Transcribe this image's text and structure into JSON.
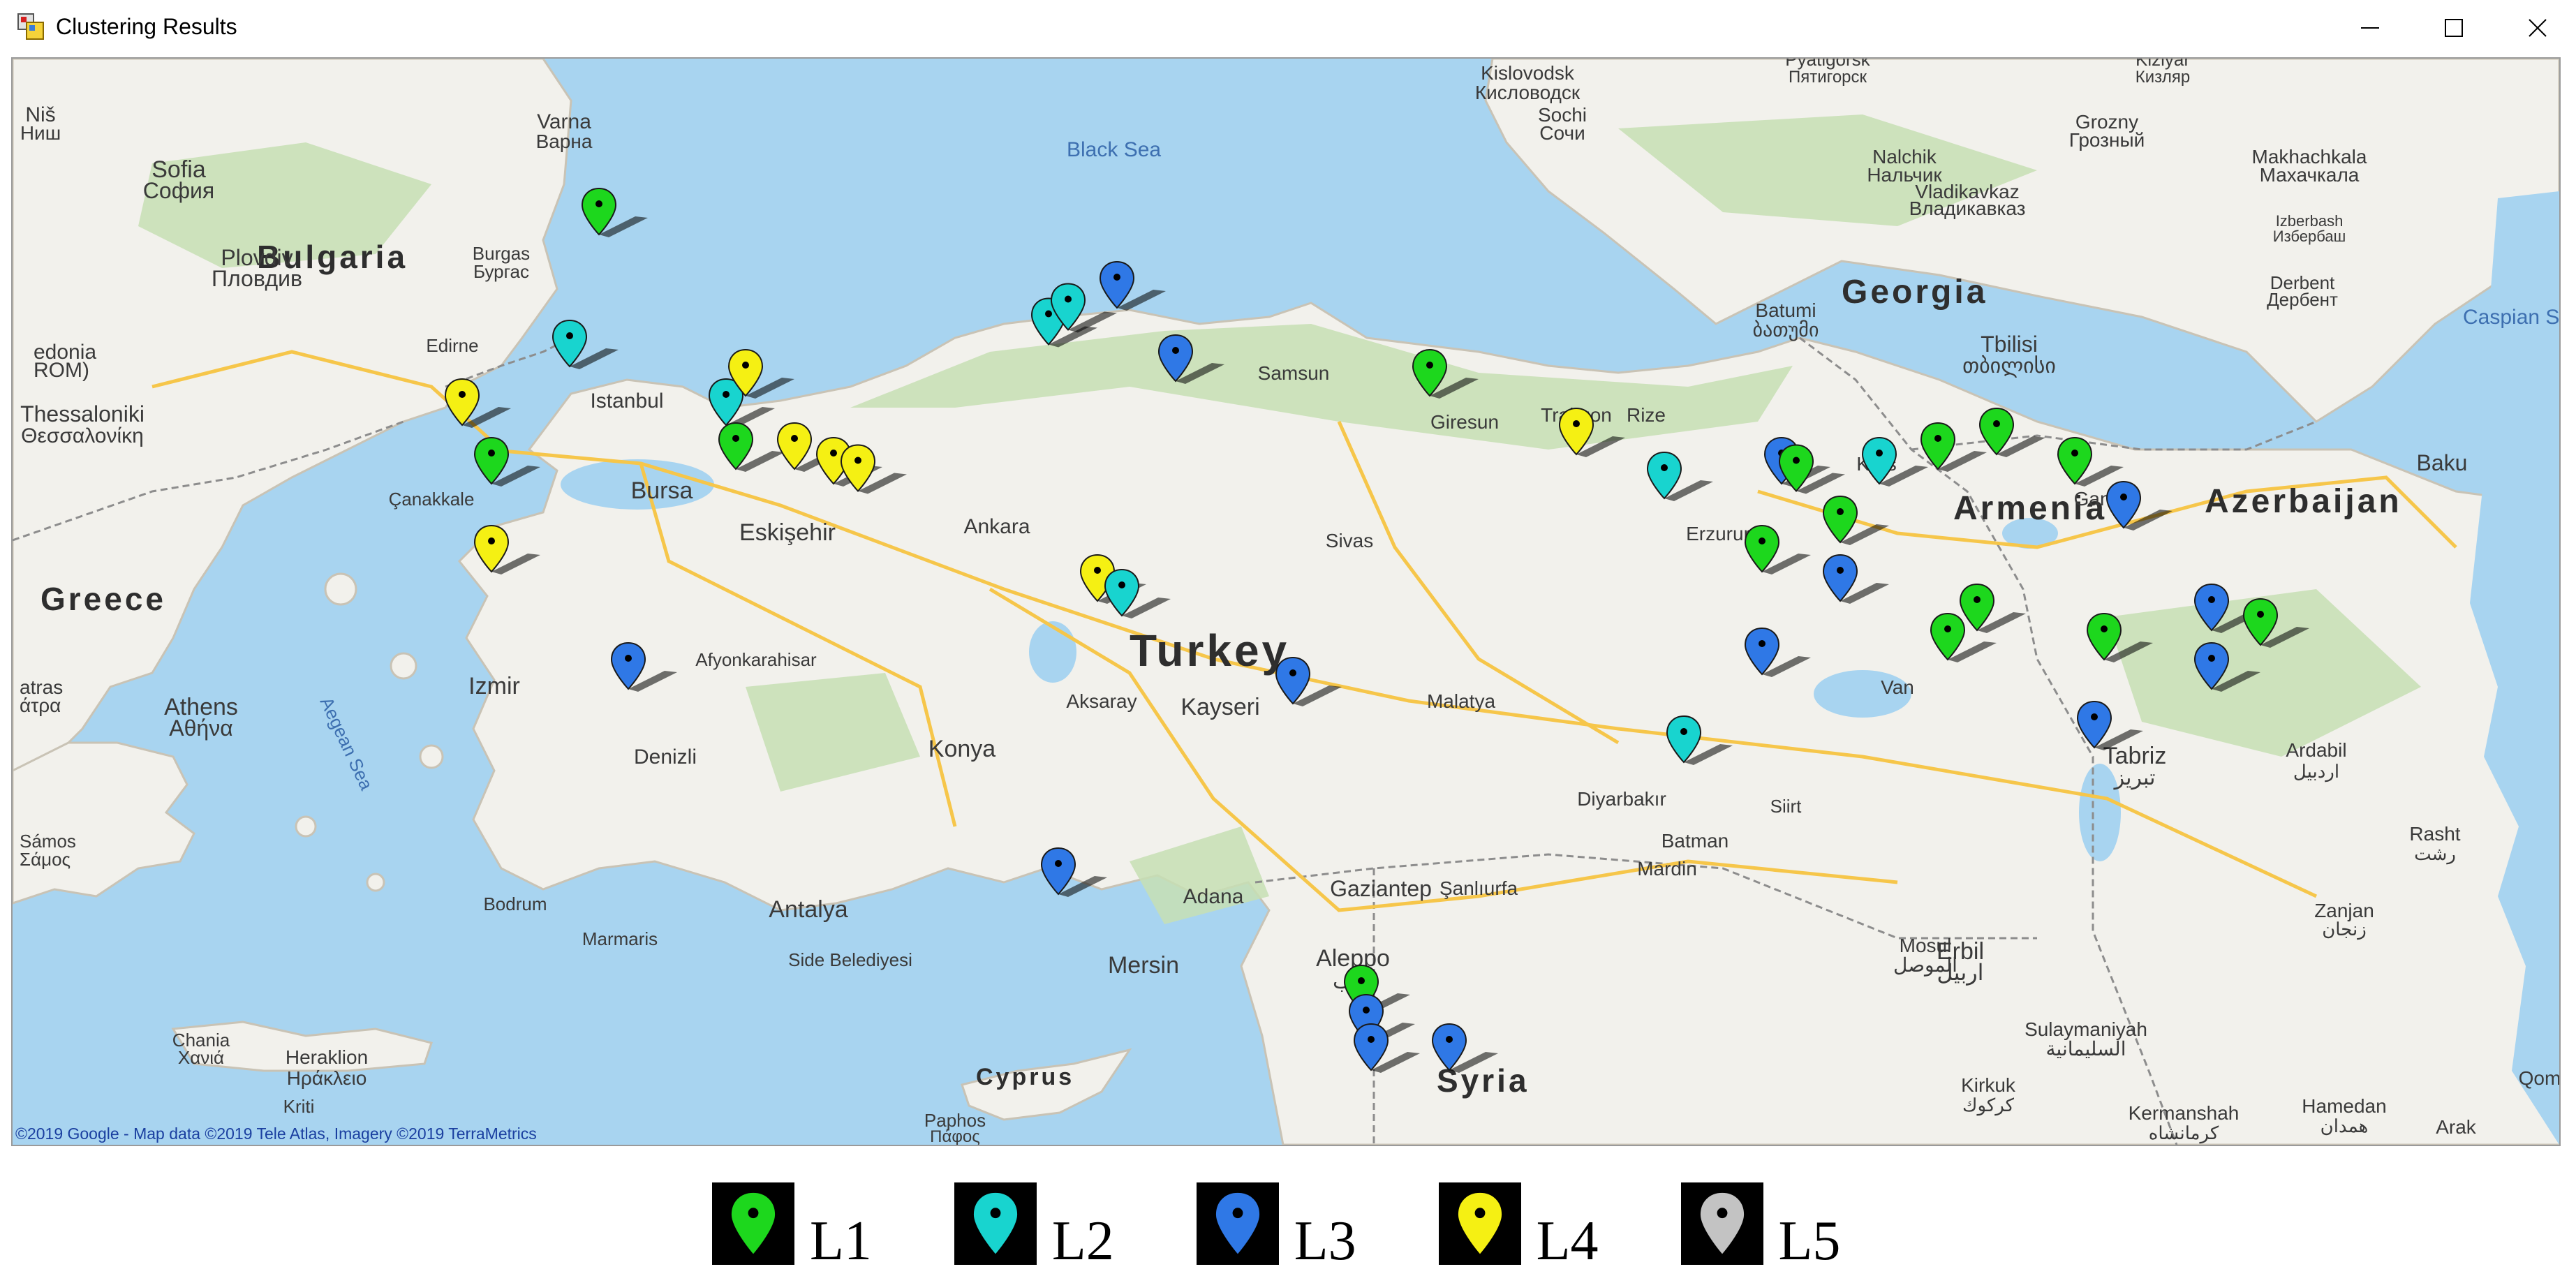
{
  "window": {
    "title": "Clustering Results",
    "buttons": [
      "minimize",
      "maximize",
      "close"
    ]
  },
  "map": {
    "attribution": "©2019 Google - Map data ©2019 Tele Atlas, Imagery ©2019 TerraMetrics",
    "countries": [
      "Bulgaria",
      "Greece",
      "Turkey",
      "Georgia",
      "Armenia",
      "Azerbaijan",
      "Syria",
      "Cyprus"
    ],
    "seas": [
      "Black Sea",
      "Caspian Sea",
      "Aegean Sea"
    ],
    "cities": [
      "Varna",
      "Варна",
      "Sofia",
      "София",
      "Burgas",
      "Бургас",
      "Plovdiv",
      "Пловдив",
      "Edirne",
      "Thessaloniki",
      "Θεσσαλονίκη",
      "Istanbul",
      "Bursa",
      "Çanakkale",
      "Eskişehir",
      "Ankara",
      "Izmir",
      "Athens",
      "Αθήνα",
      "Denizli",
      "Afyonkarahisar",
      "Konya",
      "Aksaray",
      "Kayseri",
      "Sivas",
      "Malatya",
      "Samsun",
      "Giresun",
      "Trabzon",
      "Rize",
      "Erzurum",
      "Kars",
      "Batumi",
      "ბათუმი",
      "Tbilisi",
      "თბილისი",
      "Sochi",
      "Сочи",
      "Kislovodsk",
      "Кисловодск",
      "Nalchik",
      "Нальчик",
      "Grozny",
      "Грозный",
      "Vladikavkaz",
      "Владикавказ",
      "Makhachkala",
      "Махачкала",
      "Derbent",
      "Дербент",
      "Izberbash",
      "Избербаш",
      "Baku",
      "Ganja",
      "Van",
      "Tabriz",
      "تبریز",
      "Ardabil",
      "اردبیل",
      "Diyarbakır",
      "Batman",
      "Siirt",
      "Mardin",
      "Şanlıurfa",
      "Gaziantep",
      "Adana",
      "Mersin",
      "Aleppo",
      "حلب",
      "Antalya",
      "Side Belediyesi",
      "Marmaris",
      "Bodrum",
      "Chania",
      "Χανιά",
      "Heraklion",
      "Ηράκλειο",
      "Kriti",
      "Mosul",
      "الموصل",
      "Erbil",
      "اربيل",
      "Sulaymaniyah",
      "السليمانية",
      "Kirkuk",
      "كركوك",
      "Hamedan",
      "همدان",
      "Kermanshah",
      "كرمانشاه",
      "Rasht",
      "رشت",
      "Zanjan",
      "زنجان",
      "Qom",
      "Arak",
      "Paphos",
      "Πάφος",
      "Niš",
      "Ниш",
      "Kizlyar",
      "Кизляр",
      "Pyatigorsk",
      "Пятигорск",
      "edonia",
      "ROM)",
      "atras",
      "άτρα",
      "Sámos",
      "Σάμος"
    ],
    "marker_colors": {
      "L1": "#1dd71d",
      "L2": "#18d4cf",
      "L3": "#2f78e6",
      "L4": "#f5f013",
      "L5": "#c3c3c3"
    },
    "markers": [
      {
        "c": "L1",
        "lat": 42.5,
        "lon": 27.5
      },
      {
        "c": "L2",
        "lat": 41.6,
        "lon": 27.2
      },
      {
        "c": "L4",
        "lat": 41.2,
        "lon": 26.1
      },
      {
        "c": "L1",
        "lat": 40.8,
        "lon": 26.4
      },
      {
        "c": "L4",
        "lat": 40.2,
        "lon": 26.4
      },
      {
        "c": "L2",
        "lat": 41.2,
        "lon": 28.8
      },
      {
        "c": "L4",
        "lat": 41.4,
        "lon": 29.0
      },
      {
        "c": "L1",
        "lat": 40.9,
        "lon": 28.9
      },
      {
        "c": "L4",
        "lat": 40.9,
        "lon": 29.5
      },
      {
        "c": "L4",
        "lat": 40.8,
        "lon": 29.9
      },
      {
        "c": "L4",
        "lat": 40.75,
        "lon": 30.15
      },
      {
        "c": "L3",
        "lat": 39.4,
        "lon": 27.8
      },
      {
        "c": "L2",
        "lat": 41.75,
        "lon": 32.1
      },
      {
        "c": "L2",
        "lat": 41.85,
        "lon": 32.3
      },
      {
        "c": "L3",
        "lat": 42.0,
        "lon": 32.8
      },
      {
        "c": "L3",
        "lat": 41.5,
        "lon": 33.4
      },
      {
        "c": "L4",
        "lat": 40.0,
        "lon": 32.6
      },
      {
        "c": "L2",
        "lat": 39.9,
        "lon": 32.85
      },
      {
        "c": "L3",
        "lat": 39.3,
        "lon": 34.6
      },
      {
        "c": "L3",
        "lat": 38.0,
        "lon": 32.2
      },
      {
        "c": "L1",
        "lat": 41.4,
        "lon": 36.0
      },
      {
        "c": "L4",
        "lat": 41.0,
        "lon": 37.5
      },
      {
        "c": "L2",
        "lat": 40.7,
        "lon": 38.4
      },
      {
        "c": "L2",
        "lat": 38.9,
        "lon": 38.6
      },
      {
        "c": "L3",
        "lat": 40.8,
        "lon": 39.6
      },
      {
        "c": "L1",
        "lat": 40.75,
        "lon": 39.75
      },
      {
        "c": "L2",
        "lat": 40.8,
        "lon": 40.6
      },
      {
        "c": "L1",
        "lat": 40.9,
        "lon": 41.2
      },
      {
        "c": "L1",
        "lat": 41.0,
        "lon": 41.8
      },
      {
        "c": "L1",
        "lat": 40.2,
        "lon": 39.4
      },
      {
        "c": "L1",
        "lat": 40.4,
        "lon": 40.2
      },
      {
        "c": "L3",
        "lat": 40.0,
        "lon": 40.2
      },
      {
        "c": "L3",
        "lat": 39.5,
        "lon": 39.4
      },
      {
        "c": "L1",
        "lat": 39.8,
        "lon": 41.6
      },
      {
        "c": "L1",
        "lat": 39.6,
        "lon": 41.3
      },
      {
        "c": "L1",
        "lat": 40.8,
        "lon": 42.6
      },
      {
        "c": "L3",
        "lat": 40.5,
        "lon": 43.1
      },
      {
        "c": "L1",
        "lat": 39.6,
        "lon": 42.9
      },
      {
        "c": "L3",
        "lat": 39.0,
        "lon": 42.8
      },
      {
        "c": "L3",
        "lat": 39.8,
        "lon": 44.0
      },
      {
        "c": "L3",
        "lat": 39.4,
        "lon": 44.0
      },
      {
        "c": "L1",
        "lat": 39.7,
        "lon": 44.5
      },
      {
        "c": "L1",
        "lat": 37.2,
        "lon": 35.3
      },
      {
        "c": "L3",
        "lat": 37.0,
        "lon": 35.35
      },
      {
        "c": "L3",
        "lat": 36.8,
        "lon": 35.4
      },
      {
        "c": "L3",
        "lat": 36.8,
        "lon": 36.2
      }
    ]
  },
  "legend": [
    {
      "label": "L1",
      "key": "L1"
    },
    {
      "label": "L2",
      "key": "L2"
    },
    {
      "label": "L3",
      "key": "L3"
    },
    {
      "label": "L4",
      "key": "L4"
    },
    {
      "label": "L5",
      "key": "L5"
    }
  ]
}
